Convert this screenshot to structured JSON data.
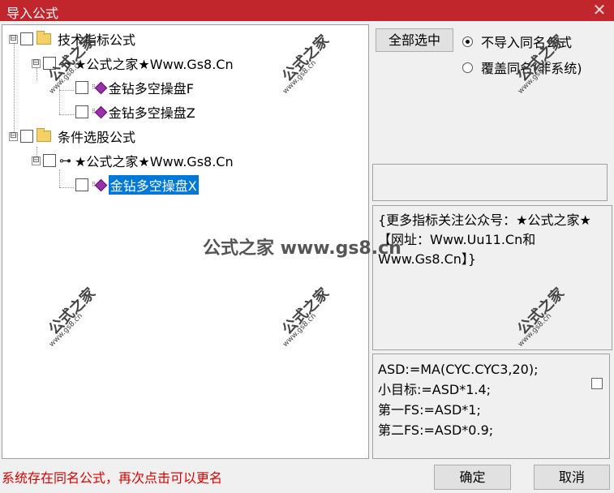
{
  "window": {
    "title": "导入公式",
    "close_glyph": "✕"
  },
  "tree": {
    "nodes": [
      {
        "label": "技术指标公式",
        "expander": "⊟"
      },
      {
        "label": "★公式之家★Www.Gs8.Cn",
        "expander": "⊟",
        "icon_glyph": "⊶"
      },
      {
        "label": "金钻多空操盘F"
      },
      {
        "label": "金钻多空操盘Z"
      },
      {
        "label": "条件选股公式",
        "expander": "⊟"
      },
      {
        "label": "★公式之家★Www.Gs8.Cn",
        "expander": "⊟",
        "icon_glyph": "⊶"
      },
      {
        "label": "金钻多空操盘X",
        "selected": true
      }
    ],
    "gem_dots": "⁝⁝"
  },
  "buttons": {
    "select_all": "全部选中",
    "ok": "确定",
    "cancel": "取消"
  },
  "options": {
    "no_import": "不导入同名公式",
    "overwrite": "覆盖同名(非系统)",
    "selected": "no_import"
  },
  "description": "{更多指标关注公众号：★公式之家★ 【网址：Www.Uu11.Cn和Www.Gs8.Cn】}",
  "code_lines": [
    "ASD:=MA(CYC.CYC3,20);",
    "小目标:=ASD*1.4;",
    "第一FS:=ASD*1;",
    "第二FS:=ASD*0.9;"
  ],
  "status": "系统存在同名公式，再次点击可以更名",
  "watermark": {
    "cn": "公式之家",
    "url": "www.gs8.cn",
    "center": "公式之家 www.gs8.cn"
  },
  "colors": {
    "title_bar": "#c1262c",
    "selection": "#0078d7",
    "status_text": "#e00000"
  }
}
